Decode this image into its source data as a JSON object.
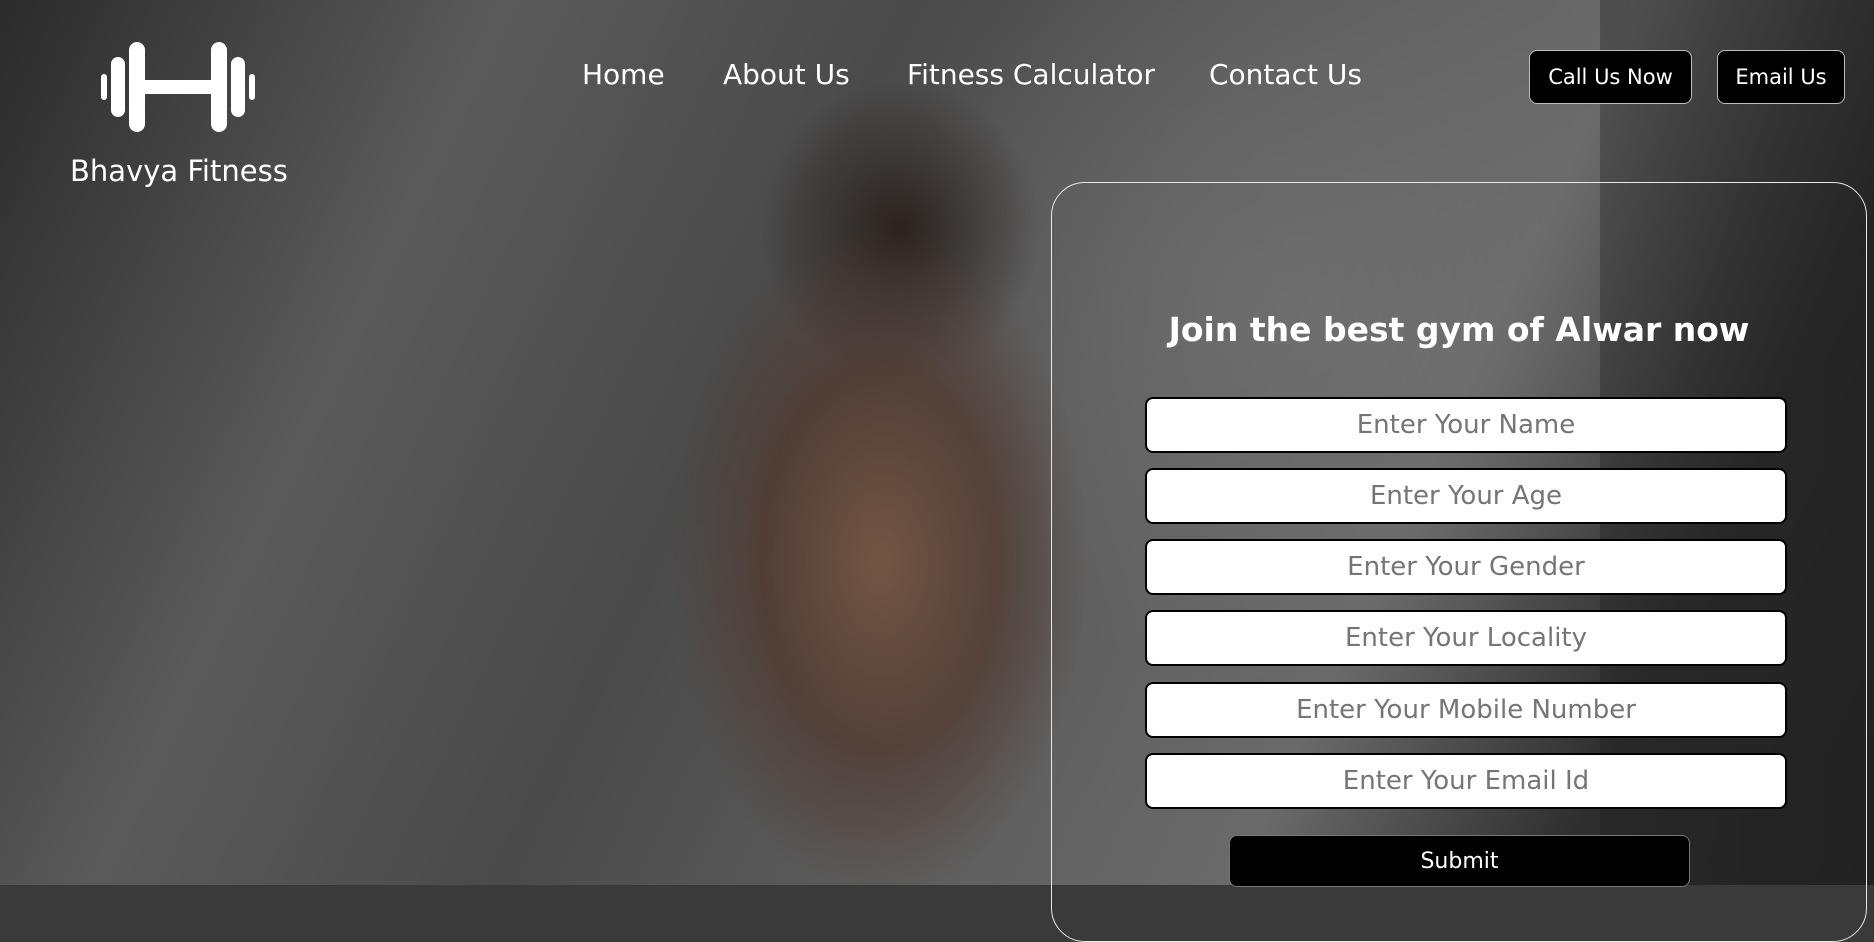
{
  "brand": {
    "name": "Bhavya Fitness",
    "logo_icon": "dumbbell-icon"
  },
  "nav": {
    "items": [
      {
        "label": "Home"
      },
      {
        "label": "About Us"
      },
      {
        "label": "Fitness Calculator"
      },
      {
        "label": "Contact Us"
      }
    ]
  },
  "header_buttons": {
    "call_label": "Call Us Now",
    "email_label": "Email Us"
  },
  "form": {
    "title": "Join the best gym of Alwar now",
    "fields": [
      {
        "placeholder": "Enter Your Name",
        "value": ""
      },
      {
        "placeholder": "Enter Your Age",
        "value": ""
      },
      {
        "placeholder": "Enter Your Gender",
        "value": ""
      },
      {
        "placeholder": "Enter Your Locality",
        "value": ""
      },
      {
        "placeholder": "Enter Your Mobile Number",
        "value": ""
      },
      {
        "placeholder": "Enter Your Email Id",
        "value": ""
      }
    ],
    "submit_label": "Submit"
  },
  "colors": {
    "button_bg": "#000000",
    "text": "#ffffff",
    "field_bg": "#ffffff",
    "placeholder": "#757575"
  }
}
